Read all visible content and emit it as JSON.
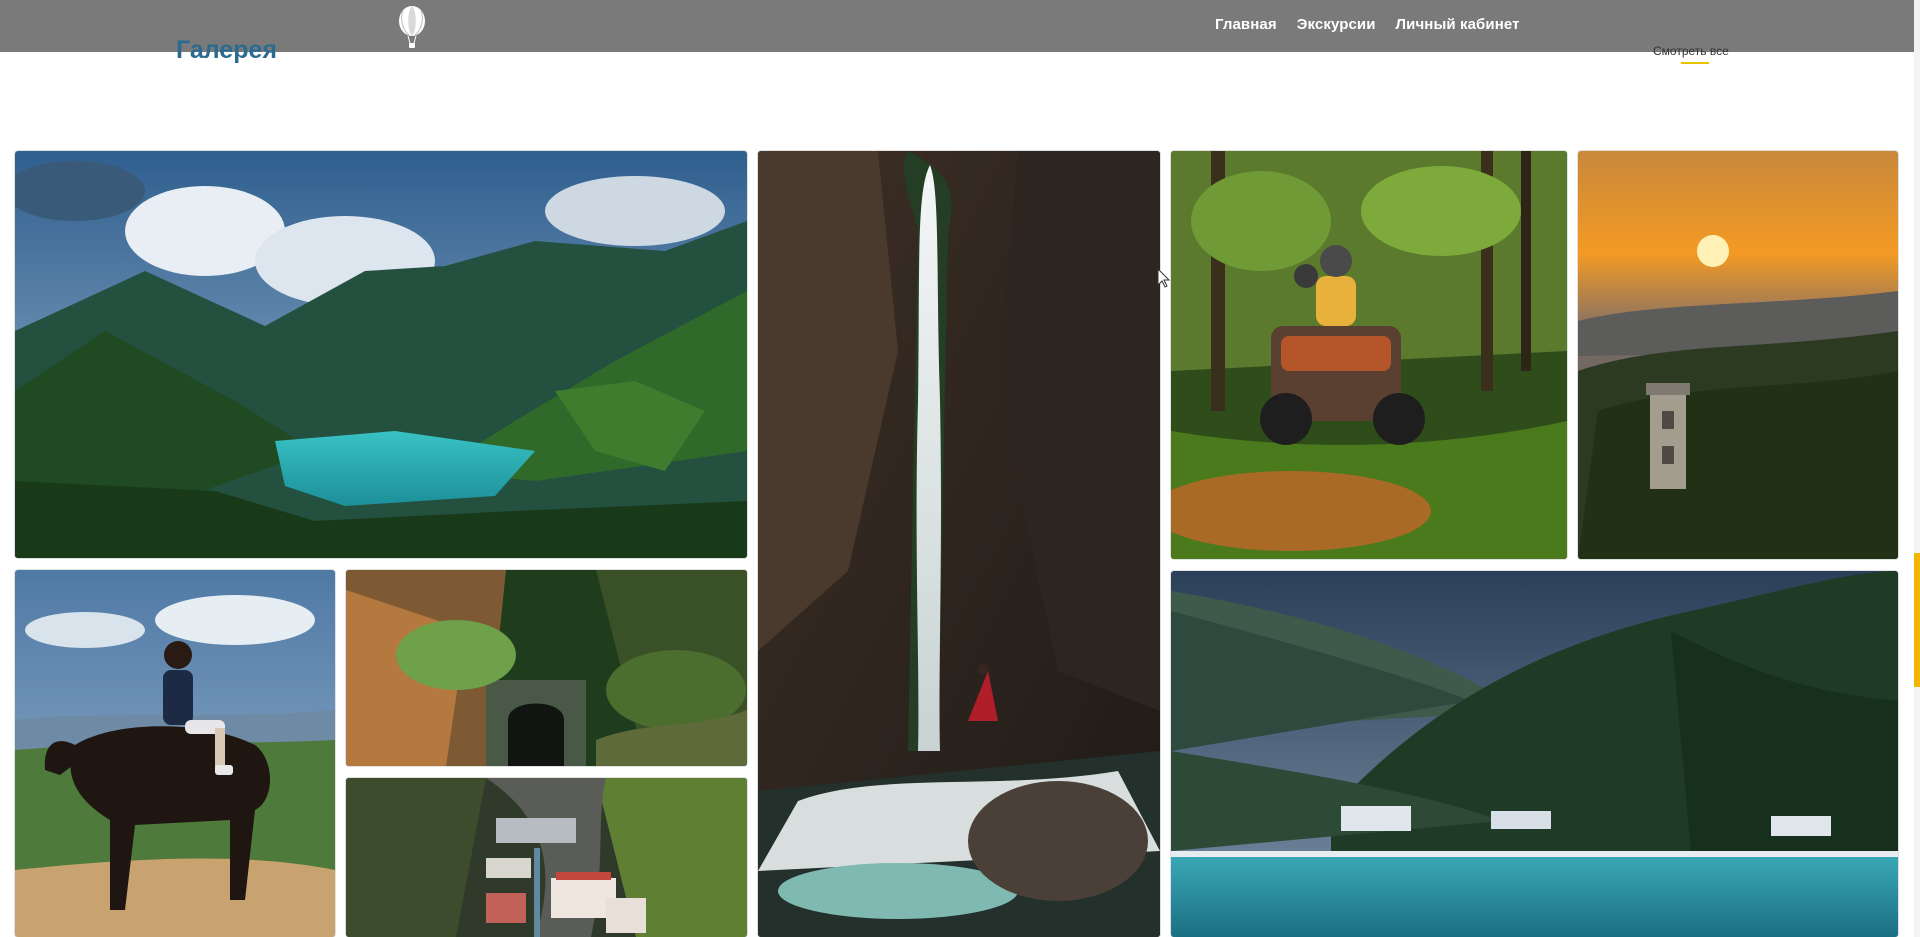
{
  "header": {
    "logo_icon": "hot-air-balloon-icon",
    "nav": [
      "Главная",
      "Экскурсии",
      "Личный кабинет"
    ]
  },
  "gallery": {
    "title": "Галерея",
    "view_all": "Смотреть все",
    "accent_color": "#e8c400",
    "title_color": "#2a6b8f",
    "images": [
      {
        "subject": "mountain-lake"
      },
      {
        "subject": "waterfall-canyon"
      },
      {
        "subject": "atv-in-forest"
      },
      {
        "subject": "sunset-tower"
      },
      {
        "subject": "horse-rider"
      },
      {
        "subject": "moss-stone-tunnel"
      },
      {
        "subject": "mountain-town"
      },
      {
        "subject": "sea-shore-mountains"
      }
    ]
  },
  "colors": {
    "header_bg": "#7a7a7a",
    "scroll_thumb": "#f2b500"
  }
}
